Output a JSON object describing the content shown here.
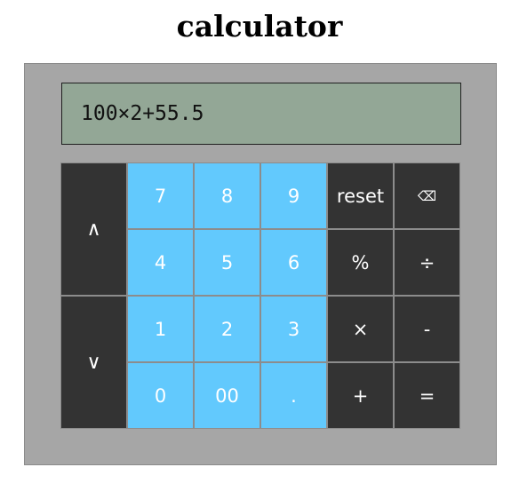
{
  "app": {
    "title": "calculator"
  },
  "display": {
    "value": "100×2+55.5"
  },
  "keys": {
    "up": "∧",
    "down": "∨",
    "k7": "7",
    "k8": "8",
    "k9": "9",
    "k4": "4",
    "k5": "5",
    "k6": "6",
    "k1": "1",
    "k2": "2",
    "k3": "3",
    "k0": "0",
    "k00": "00",
    "dot": ".",
    "reset": "reset",
    "backspace": "⌫",
    "percent": "%",
    "divide": "÷",
    "multiply": "×",
    "minus": "-",
    "plus": "+",
    "equals": "="
  },
  "colors": {
    "number_key": "#62c9fd",
    "operator_key": "#333333",
    "display_bg": "#93a796",
    "panel_bg": "#a6a6a6"
  }
}
